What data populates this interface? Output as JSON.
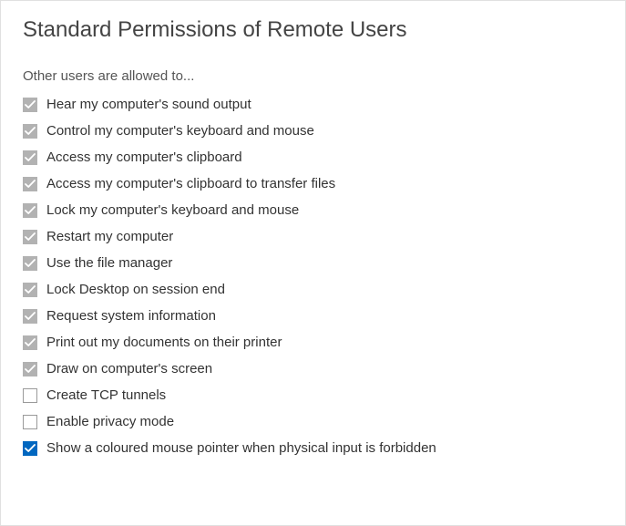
{
  "panel": {
    "title": "Standard Permissions of Remote Users",
    "section_label": "Other users are allowed to..."
  },
  "permissions": [
    {
      "label": "Hear my computer's sound output",
      "state": "checked-grey"
    },
    {
      "label": "Control my computer's keyboard and mouse",
      "state": "checked-grey"
    },
    {
      "label": "Access my computer's clipboard",
      "state": "checked-grey"
    },
    {
      "label": "Access my computer's clipboard to transfer files",
      "state": "checked-grey"
    },
    {
      "label": "Lock my computer's keyboard and mouse",
      "state": "checked-grey"
    },
    {
      "label": "Restart my computer",
      "state": "checked-grey"
    },
    {
      "label": "Use the file manager",
      "state": "checked-grey"
    },
    {
      "label": "Lock Desktop on session end",
      "state": "checked-grey"
    },
    {
      "label": "Request system information",
      "state": "checked-grey"
    },
    {
      "label": "Print out my documents on their printer",
      "state": "checked-grey"
    },
    {
      "label": "Draw on computer's screen",
      "state": "checked-grey"
    },
    {
      "label": "Create TCP tunnels",
      "state": "unchecked"
    },
    {
      "label": "Enable privacy mode",
      "state": "unchecked"
    }
  ],
  "extra": {
    "label": "Show a coloured mouse pointer when physical input is forbidden",
    "state": "checked-blue"
  }
}
